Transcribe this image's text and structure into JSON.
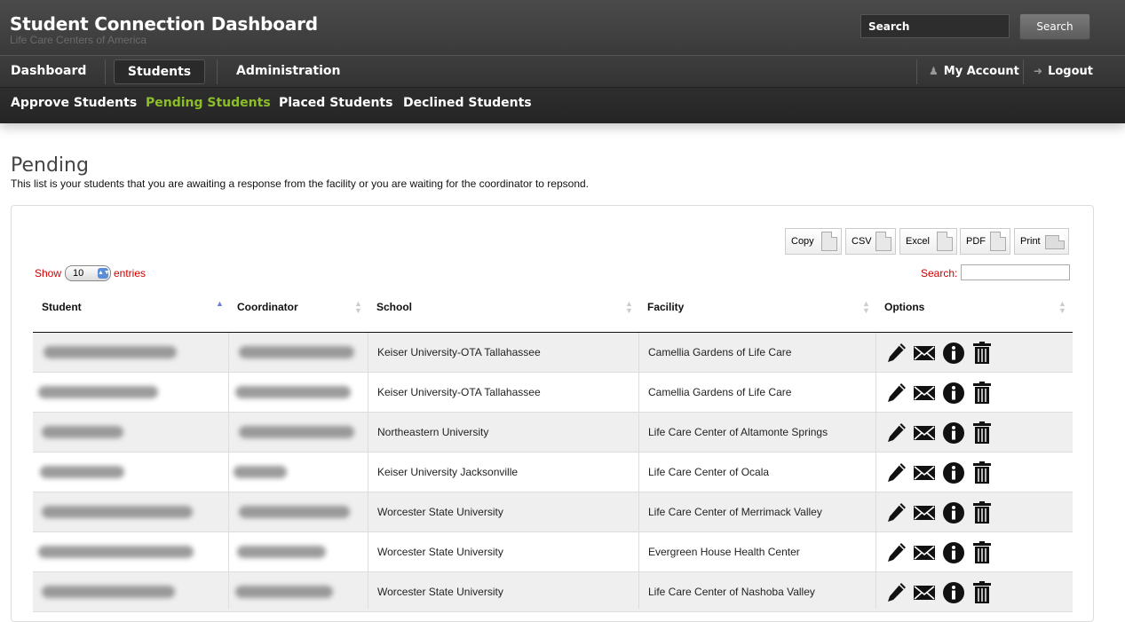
{
  "header": {
    "title": "Student Connection Dashboard",
    "subtitle": "Life Care Centers of America",
    "search_value": "Search",
    "search_button": "Search"
  },
  "nav": {
    "items": [
      "Dashboard",
      "Students",
      "Administration"
    ],
    "active": "Students",
    "account": "My Account",
    "logout": "Logout"
  },
  "subnav": {
    "items": [
      "Approve Students",
      "Pending Students",
      "Placed Students",
      "Declined Students"
    ],
    "active": "Pending Students"
  },
  "page": {
    "title": "Pending",
    "description": "This list is your students that you are awaiting a response from the facility or you are waiting for the coordinator to repsond."
  },
  "tools": [
    "Copy",
    "CSV",
    "Excel",
    "PDF",
    "Print"
  ],
  "table_controls": {
    "show_label": "Show",
    "page_size": "10",
    "entries_label": "entries",
    "search_label": "Search:"
  },
  "columns": [
    "Student",
    "Coordinator",
    "School",
    "Facility",
    "Options"
  ],
  "rows": [
    {
      "school": "Keiser University-OTA Tallahassee",
      "facility": "Camellia Gardens of Life Care"
    },
    {
      "school": "Keiser University-OTA Tallahassee",
      "facility": "Camellia Gardens of Life Care"
    },
    {
      "school": "Northeastern University",
      "facility": "Life Care Center of Altamonte Springs"
    },
    {
      "school": "Keiser University Jacksonville",
      "facility": "Life Care Center of Ocala"
    },
    {
      "school": "Worcester State University",
      "facility": "Life Care Center of Merrimack Valley"
    },
    {
      "school": "Worcester State University",
      "facility": "Evergreen House Health Center"
    },
    {
      "school": "Worcester State University",
      "facility": "Life Care Center of Nashoba Valley"
    }
  ],
  "icons": {
    "edit": "pencil-icon",
    "email": "envelope-icon",
    "info": "info-icon",
    "delete": "trash-icon"
  }
}
